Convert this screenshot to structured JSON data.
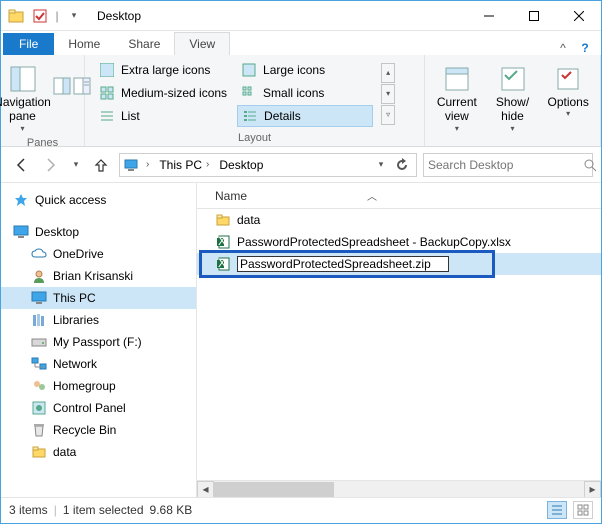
{
  "title": "Desktop",
  "tabs": {
    "file": "File",
    "home": "Home",
    "share": "Share",
    "view": "View"
  },
  "ribbon": {
    "panes": {
      "navigation": "Navigation\npane",
      "group_label": "Panes"
    },
    "layout": {
      "extra_large": "Extra large icons",
      "large": "Large icons",
      "medium": "Medium-sized icons",
      "small": "Small icons",
      "list": "List",
      "details": "Details",
      "group_label": "Layout"
    },
    "current_view": {
      "current": "Current\nview",
      "showhide": "Show/\nhide",
      "options": "Options"
    }
  },
  "breadcrumb": {
    "this_pc": "This PC",
    "desktop": "Desktop"
  },
  "search": {
    "placeholder": "Search Desktop"
  },
  "tree": {
    "quick_access": "Quick access",
    "desktop": "Desktop",
    "onedrive": "OneDrive",
    "user": "Brian Krisanski",
    "this_pc": "This PC",
    "libraries": "Libraries",
    "drive": "My Passport (F:)",
    "network": "Network",
    "homegroup": "Homegroup",
    "control_panel": "Control Panel",
    "recycle": "Recycle Bin",
    "data": "data"
  },
  "columns": {
    "name": "Name"
  },
  "files": {
    "data": "data",
    "backup": "PasswordProtectedSpreadsheet - BackupCopy.xlsx",
    "rename_value": "PasswordProtectedSpreadsheet.zip"
  },
  "status": {
    "count": "3 items",
    "selection": "1 item selected",
    "size": "9.68 KB"
  }
}
